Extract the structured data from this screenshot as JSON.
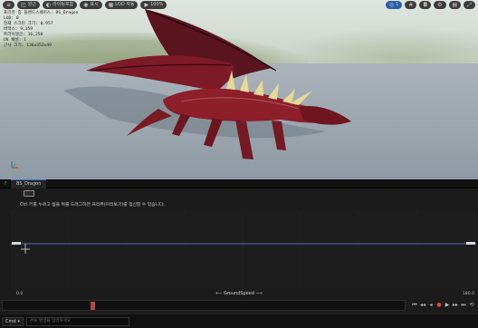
{
  "viewport": {
    "toolbar_left": [
      {
        "icon": "hamburger-icon",
        "label": ""
      },
      {
        "icon": "perspective-icon",
        "label": "원근"
      },
      {
        "icon": "lit-icon",
        "label": "라이팅포함"
      },
      {
        "icon": "show-icon",
        "label": "표시"
      },
      {
        "icon": "lod-icon",
        "label": "LOD 자동"
      },
      {
        "icon": "play-icon",
        "label": "100%"
      }
    ],
    "toolbar_right": [
      {
        "icon": "speed-icon",
        "label": "1"
      },
      {
        "icon": "grid-icon",
        "label": ""
      },
      {
        "icon": "camera-icon",
        "label": ""
      },
      {
        "icon": "settings-icon",
        "label": ""
      },
      {
        "icon": "layout-icon",
        "label": ""
      },
      {
        "icon": "maximize-icon",
        "label": ""
      }
    ],
    "stats": [
      "프리뷰 중 블렌드스페이스: BS_Dragon",
      "LOD: 0",
      "현재 스크린 크기: 0.957",
      "버텍스: 9,359",
      "트라이앵글: 16,258",
      "UV 채널: 1",
      "근사 크기: 136x352x49"
    ]
  },
  "panel": {
    "help_glyph": "?",
    "tab_title": "BS_Dragon",
    "hint": "Ctrl 키를 누르고 샘플 위를 드래그하면 프리뷰(미리보기)를 갱신할 수 있습니다.",
    "x_min": "0.0",
    "x_max": "180.0",
    "x_axis_label": "GroundSpeed",
    "arrow_left": "⟵",
    "arrow_right": "⟶",
    "samples": [
      0.0,
      180.0
    ],
    "preview_x": 0.0,
    "timeline_position": 0.22,
    "transport": [
      "⏮",
      "◂◂",
      "◂",
      "●",
      "▶",
      "▸▸",
      "⏭",
      "⟲"
    ]
  },
  "console": {
    "select_label": "Cmd",
    "select_caret": "▾",
    "placeholder": "콘솔 명령을 입력하세요"
  },
  "colors": {
    "accent": "#2f7ad8",
    "record": "#e0463a",
    "curve": "#4d6fb0"
  }
}
